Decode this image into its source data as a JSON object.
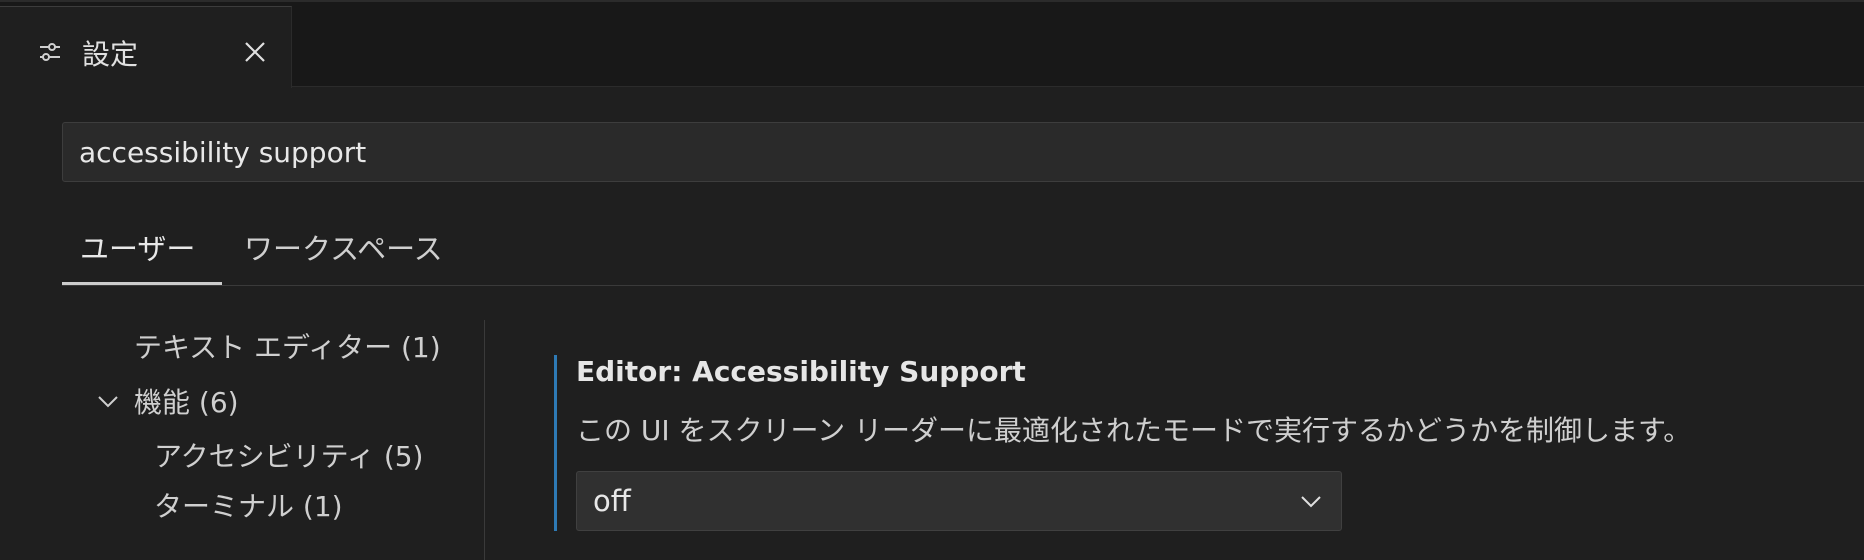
{
  "tab": {
    "title": "設定",
    "icon": "settings-sliders-icon",
    "close_icon": "close-icon"
  },
  "search": {
    "value": "accessibility support"
  },
  "scopes": {
    "user": "ユーザー",
    "workspace": "ワークスペース"
  },
  "toc": {
    "items": [
      {
        "label": "テキスト エディター (1)"
      },
      {
        "label": "機能 (6)",
        "expanded": true
      },
      {
        "label": "アクセシビリティ (5)"
      },
      {
        "label": "ターミナル (1)"
      }
    ]
  },
  "setting": {
    "title": "Editor: Accessibility Support",
    "description": "この UI をスクリーン リーダーに最適化されたモードで実行するかどうかを制御します。",
    "value": "off"
  },
  "colors": {
    "modified_bar": "#2e7ab5",
    "background": "#1f1f1f"
  }
}
